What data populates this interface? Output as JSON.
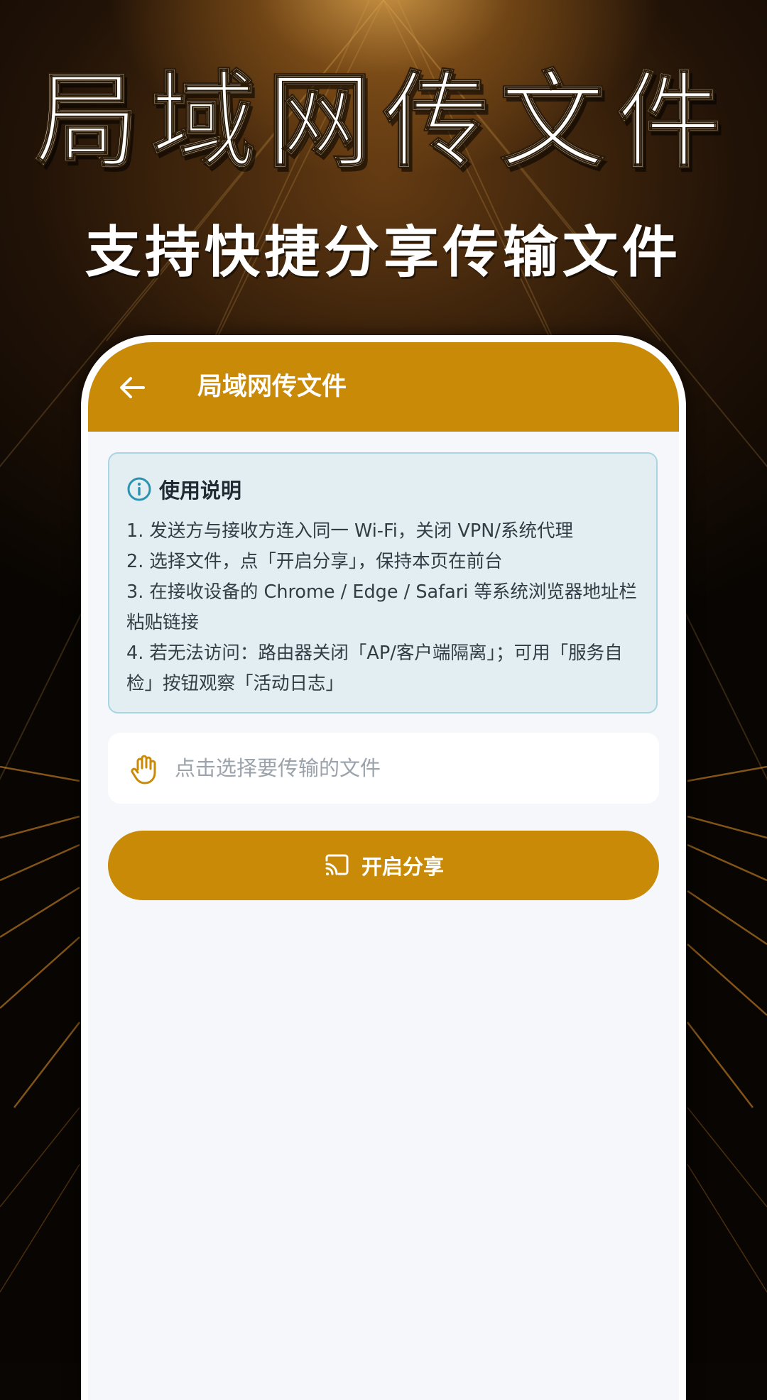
{
  "banner": {
    "title": "局域网传文件",
    "subtitle": "支持快捷分享传输文件"
  },
  "app_bar": {
    "back_icon": "arrow-left-icon",
    "title": "局域网传文件"
  },
  "instructions": {
    "icon": "info-icon",
    "title": "使用说明",
    "lines": [
      "1. 发送方与接收方连入同一 Wi-Fi，关闭 VPN/系统代理",
      "2. 选择文件，点「开启分享」，保持本页在前台",
      "3. 在接收设备的 Chrome / Edge / Safari 等系统浏览器地址栏粘贴链接",
      "4. 若无法访问：路由器关闭「AP/客户端隔离」；可用「服务自检」按钮观察「活动日志」"
    ]
  },
  "file_picker": {
    "icon": "hand-icon",
    "placeholder": "点击选择要传输的文件"
  },
  "share_button": {
    "icon": "cast-icon",
    "label": "开启分享"
  },
  "colors": {
    "accent": "#c98a07",
    "card_bg": "#e3eef3",
    "card_border": "#a9d4e2",
    "info_icon": "#2a93b0",
    "screen_bg": "#f5f7fa"
  }
}
